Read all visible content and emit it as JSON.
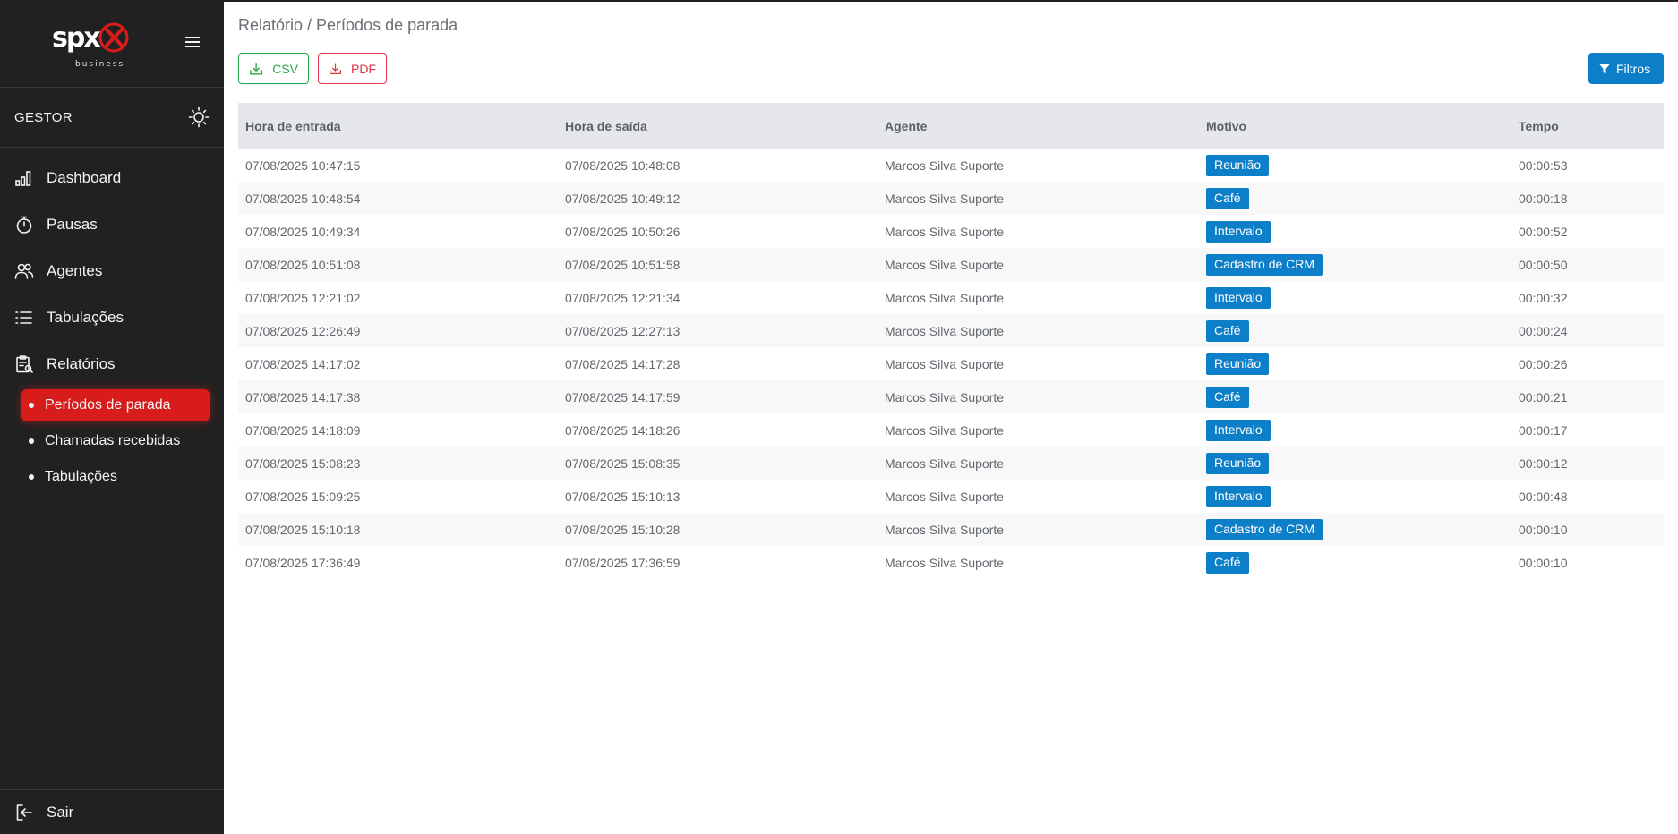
{
  "app": {
    "logo_text": "spx",
    "logo_sub": "business",
    "role": "GESTOR"
  },
  "sidebar": {
    "items": [
      {
        "label": "Dashboard",
        "icon": "chart-bar-icon"
      },
      {
        "label": "Pausas",
        "icon": "stopwatch-icon"
      },
      {
        "label": "Agentes",
        "icon": "users-icon"
      },
      {
        "label": "Tabulações",
        "icon": "list-icon"
      },
      {
        "label": "Relatórios",
        "icon": "report-clipboard-icon"
      }
    ],
    "subitems": [
      {
        "label": "Períodos de parada",
        "active": true
      },
      {
        "label": "Chamadas recebidas",
        "active": false
      },
      {
        "label": "Tabulações",
        "active": false
      }
    ],
    "logout_label": "Sair"
  },
  "breadcrumb": "Relatório / Períodos de parada",
  "toolbar": {
    "csv_label": "CSV",
    "pdf_label": "PDF",
    "filter_label": "Filtros"
  },
  "colors": {
    "sidebar_bg": "#212121",
    "active_red": "#d81c1c",
    "badge_blue": "#0d7fc8",
    "csv_green": "#28a745",
    "pdf_red": "#dc3545"
  },
  "table": {
    "headers": [
      "Hora de entrada",
      "Hora de saída",
      "Agente",
      "Motivo",
      "Tempo"
    ],
    "rows": [
      [
        "07/08/2025 10:47:15",
        "07/08/2025 10:48:08",
        "Marcos Silva Suporte",
        "Reunião",
        "00:00:53"
      ],
      [
        "07/08/2025 10:48:54",
        "07/08/2025 10:49:12",
        "Marcos Silva Suporte",
        "Café",
        "00:00:18"
      ],
      [
        "07/08/2025 10:49:34",
        "07/08/2025 10:50:26",
        "Marcos Silva Suporte",
        "Intervalo",
        "00:00:52"
      ],
      [
        "07/08/2025 10:51:08",
        "07/08/2025 10:51:58",
        "Marcos Silva Suporte",
        "Cadastro de CRM",
        "00:00:50"
      ],
      [
        "07/08/2025 12:21:02",
        "07/08/2025 12:21:34",
        "Marcos Silva Suporte",
        "Intervalo",
        "00:00:32"
      ],
      [
        "07/08/2025 12:26:49",
        "07/08/2025 12:27:13",
        "Marcos Silva Suporte",
        "Café",
        "00:00:24"
      ],
      [
        "07/08/2025 14:17:02",
        "07/08/2025 14:17:28",
        "Marcos Silva Suporte",
        "Reunião",
        "00:00:26"
      ],
      [
        "07/08/2025 14:17:38",
        "07/08/2025 14:17:59",
        "Marcos Silva Suporte",
        "Café",
        "00:00:21"
      ],
      [
        "07/08/2025 14:18:09",
        "07/08/2025 14:18:26",
        "Marcos Silva Suporte",
        "Intervalo",
        "00:00:17"
      ],
      [
        "07/08/2025 15:08:23",
        "07/08/2025 15:08:35",
        "Marcos Silva Suporte",
        "Reunião",
        "00:00:12"
      ],
      [
        "07/08/2025 15:09:25",
        "07/08/2025 15:10:13",
        "Marcos Silva Suporte",
        "Intervalo",
        "00:00:48"
      ],
      [
        "07/08/2025 15:10:18",
        "07/08/2025 15:10:28",
        "Marcos Silva Suporte",
        "Cadastro de CRM",
        "00:00:10"
      ],
      [
        "07/08/2025 17:36:49",
        "07/08/2025 17:36:59",
        "Marcos Silva Suporte",
        "Café",
        "00:00:10"
      ]
    ]
  }
}
